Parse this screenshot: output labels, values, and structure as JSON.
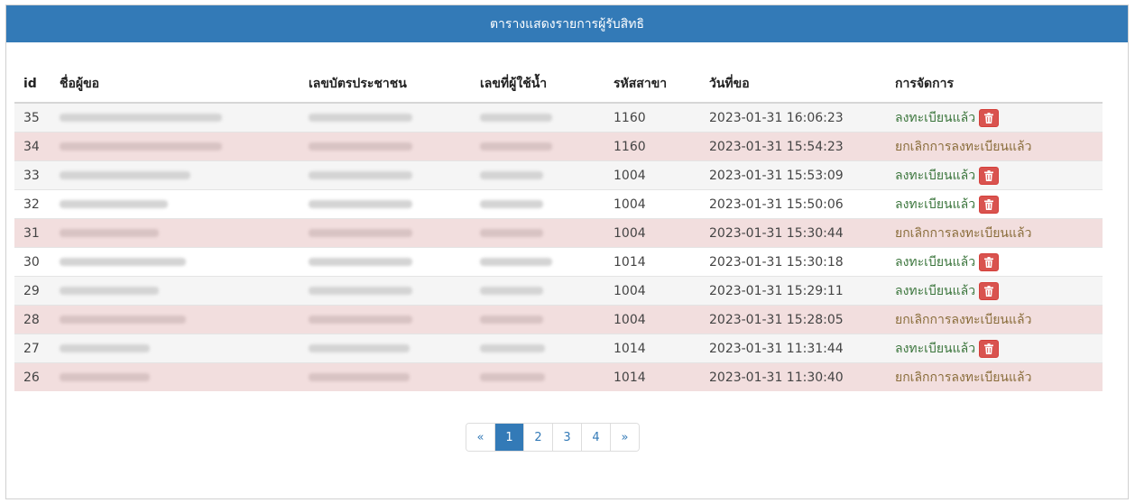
{
  "panel": {
    "title": "ตารางแสดงรายการผู้รับสิทธิ"
  },
  "table": {
    "headers": [
      "id",
      "ชื่อผู้ขอ",
      "เลขบัตรประชาชน",
      "เลขที่ผู้ใช้น้ำ",
      "รหัสสาขา",
      "วันที่ขอ",
      "การจัดการ"
    ],
    "rows": [
      {
        "id": "35",
        "branch": "1160",
        "date": "2023-01-31 16:06:23",
        "status": "ลงทะเบียนแล้ว",
        "type": "ok"
      },
      {
        "id": "34",
        "branch": "1160",
        "date": "2023-01-31 15:54:23",
        "status": "ยกเลิกการลงทะเบียนแล้ว",
        "type": "cancel"
      },
      {
        "id": "33",
        "branch": "1004",
        "date": "2023-01-31 15:53:09",
        "status": "ลงทะเบียนแล้ว",
        "type": "ok"
      },
      {
        "id": "32",
        "branch": "1004",
        "date": "2023-01-31 15:50:06",
        "status": "ลงทะเบียนแล้ว",
        "type": "ok"
      },
      {
        "id": "31",
        "branch": "1004",
        "date": "2023-01-31 15:30:44",
        "status": "ยกเลิกการลงทะเบียนแล้ว",
        "type": "cancel"
      },
      {
        "id": "30",
        "branch": "1014",
        "date": "2023-01-31 15:30:18",
        "status": "ลงทะเบียนแล้ว",
        "type": "ok"
      },
      {
        "id": "29",
        "branch": "1004",
        "date": "2023-01-31 15:29:11",
        "status": "ลงทะเบียนแล้ว",
        "type": "ok"
      },
      {
        "id": "28",
        "branch": "1004",
        "date": "2023-01-31 15:28:05",
        "status": "ยกเลิกการลงทะเบียนแล้ว",
        "type": "cancel"
      },
      {
        "id": "27",
        "branch": "1014",
        "date": "2023-01-31 11:31:44",
        "status": "ลงทะเบียนแล้ว",
        "type": "ok"
      },
      {
        "id": "26",
        "branch": "1014",
        "date": "2023-01-31 11:30:40",
        "status": "ยกเลิกการลงทะเบียนแล้ว",
        "type": "cancel"
      }
    ]
  },
  "pagination": {
    "prev": "«",
    "pages": [
      "1",
      "2",
      "3",
      "4"
    ],
    "active": "1",
    "next": "»"
  },
  "colors": {
    "header_bar": "#337ab7",
    "cancel_row": "#f2dede",
    "status_ok": "#3c763d",
    "status_cancel": "#8a6d3b",
    "delete_button": "#d9534f"
  },
  "icons": {
    "delete": "trash-icon"
  }
}
